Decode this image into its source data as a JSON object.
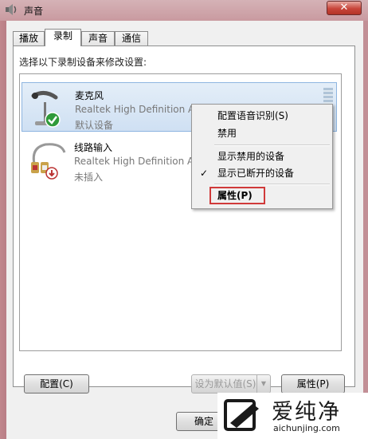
{
  "window": {
    "title": "声音",
    "close_label": "✕"
  },
  "tabs": [
    {
      "label": "播放",
      "active": false
    },
    {
      "label": "录制",
      "active": true
    },
    {
      "label": "声音",
      "active": false
    },
    {
      "label": "通信",
      "active": false
    }
  ],
  "panel": {
    "instruction": "选择以下录制设备来修改设置:"
  },
  "devices": [
    {
      "name": "麦克风",
      "description": "Realtek High Definition Audio",
      "status": "默认设备",
      "icon": "microphone-icon",
      "badge": "green-check-icon",
      "selected": true
    },
    {
      "name": "线路输入",
      "description": "Realtek High Definition Audio",
      "status": "未插入",
      "icon": "line-in-cable-icon",
      "badge": "red-down-arrow-icon",
      "selected": false
    }
  ],
  "context_menu": {
    "items": [
      {
        "label": "配置语音识别(S)"
      },
      {
        "label": "禁用"
      },
      {
        "label": "显示禁用的设备"
      },
      {
        "label": "显示已断开的设备",
        "checked": true
      },
      {
        "label": "属性(P)",
        "highlighted": true
      }
    ]
  },
  "buttons": {
    "configure": "配置(C)",
    "set_default": "设为默认值(S)",
    "properties": "属性(P)",
    "ok": "确定"
  },
  "watermark": {
    "brand": "爱纯净",
    "url": "aichunjing.com"
  },
  "colors": {
    "highlight_border": "#d03a3a",
    "selected_bg": "#cfe0f3",
    "close_red": "#c8453a"
  }
}
